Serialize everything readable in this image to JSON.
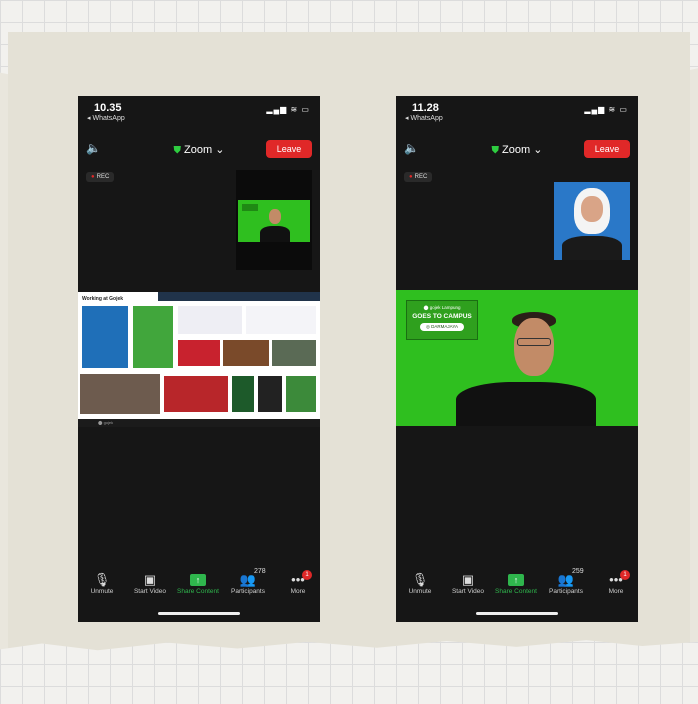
{
  "phones": [
    {
      "status": {
        "time": "10.35",
        "back": "◂ WhatsApp",
        "signal": "▂▄▆ ≋ ▭"
      },
      "topbar": {
        "speaker_icon": "speaker-icon",
        "app_label": "Zoom ⌄",
        "leave_label": "Leave"
      },
      "rec_label": "REC",
      "share": {
        "title": "Working at Gojek",
        "footer": "⬤ gojek"
      },
      "toolbar": {
        "unmute": "Unmute",
        "start_video": "Start Video",
        "share_content": "Share Content",
        "participants": "Participants",
        "participants_count": "278",
        "more": "More",
        "more_badge": "1"
      }
    },
    {
      "status": {
        "time": "11.28",
        "back": "◂ WhatsApp",
        "signal": "▂▄▆ ≋ ▭"
      },
      "topbar": {
        "speaker_icon": "speaker-icon",
        "app_label": "Zoom ⌄",
        "leave_label": "Leave"
      },
      "rec_label": "REC",
      "banner": {
        "top": "⬤ gojek Lampung",
        "main": "GOES TO CAMPUS",
        "pill": "◎ DARMAJAYA"
      },
      "toolbar": {
        "unmute": "Unmute",
        "start_video": "Start Video",
        "share_content": "Share Content",
        "participants": "Participants",
        "participants_count": "259",
        "more": "More",
        "more_badge": "1"
      }
    }
  ],
  "colors": {
    "leave": "#e02828",
    "green_screen": "#2fbf1f",
    "share_green": "#2fb64d"
  }
}
